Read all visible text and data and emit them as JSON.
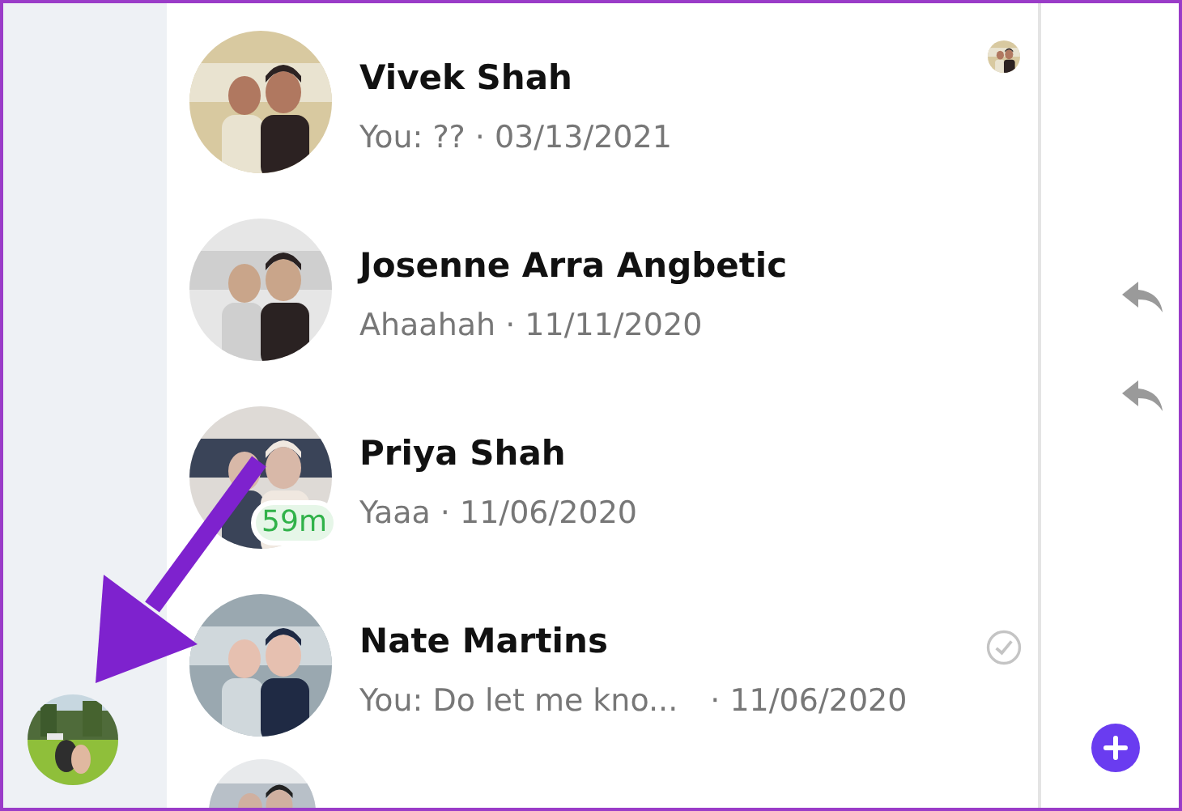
{
  "conversations": [
    {
      "name": "Vivek Shah",
      "preview": "You: ??",
      "time": "· 03/13/2021",
      "kind": "seen"
    },
    {
      "name": "Josenne Arra Angbetic",
      "preview": "Ahaahah",
      "time": "· 11/11/2020",
      "kind": "plain"
    },
    {
      "name": "Priya Shah",
      "preview": "Yaaa",
      "time": "· 11/06/2020",
      "kind": "plain",
      "active_ago": "59m"
    },
    {
      "name": "Nate Martins",
      "preview": "You: Do let me kno...",
      "time": "· 11/06/2020",
      "kind": "sent"
    }
  ]
}
